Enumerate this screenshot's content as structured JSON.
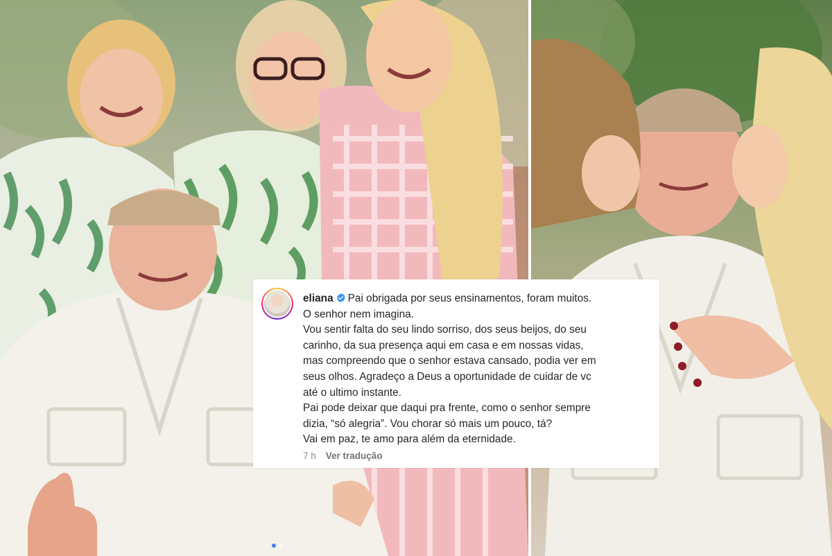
{
  "post": {
    "username": "eliana",
    "verified_icon": "verified-badge-icon",
    "caption_lines": [
      "Pai obrigada por seus ensinamentos, foram muitos.",
      "O senhor nem imagina.",
      "Vou sentir falta do seu lindo sorriso, dos seus beijos, do seu",
      "carinho, da sua presença aqui em casa e em nossas vidas,",
      "mas compreendo que o senhor estava cansado, podia ver em",
      "seus olhos. Agradeço a Deus a oportunidade de cuidar de vc",
      "até o ultimo instante.",
      "Pai pode deixar que daqui pra frente, como o senhor sempre",
      "dizia, “só alegria”. Vou chorar só mais um pouco, tá?",
      "Vai em paz, te amo para além da eternidade."
    ],
    "timestamp": "7 h",
    "translate_label": "Ver tradução"
  },
  "carousel": {
    "count": 2,
    "active_index": 0
  },
  "colors": {
    "verified_blue": "#3897f0",
    "text": "#262626",
    "muted": "#8e8e8e"
  }
}
